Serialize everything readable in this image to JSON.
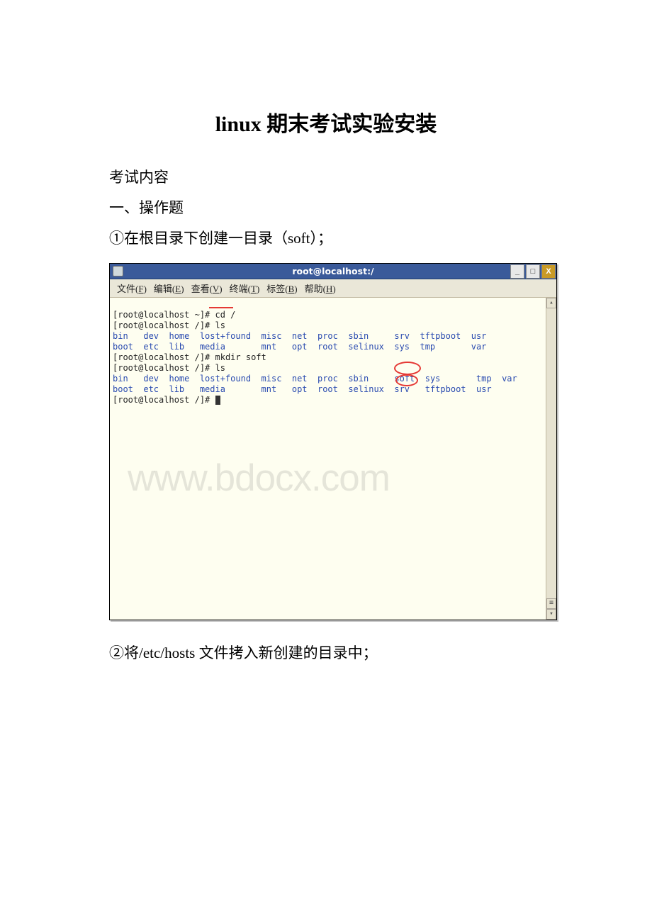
{
  "doc": {
    "title": "linux 期末考试实验安装",
    "subtitle": "考试内容",
    "section": "一、操作题",
    "q1": "①在根目录下创建一目录（soft）；",
    "q2": "②将/etc/hosts 文件拷入新创建的目录中；"
  },
  "terminal": {
    "title": "root@localhost:/",
    "menu": {
      "file": "文件(F)",
      "edit": "编辑(E)",
      "view": "查看(V)",
      "term": "终端(T)",
      "tabs": "标签(B)",
      "help": "帮助(H)"
    },
    "btn": {
      "min": "_",
      "max": "□",
      "close": "X"
    },
    "lines": {
      "l1": "[root@localhost ~]# cd /",
      "l2": "[root@localhost /]# ls",
      "l3a": "bin   dev  home  lost+found  misc  net  proc  sbin     srv  tftpboot  usr",
      "l3b": "boot  etc  lib   media       mnt   opt  root  selinux  sys  tmp       var",
      "l4": "[root@localhost /]# mkdir soft",
      "l5": "[root@localhost /]# ls",
      "l6a_pre": "bin   dev  home  lost+found  misc  net  proc  sbin     ",
      "l6a_soft": "soft",
      "l6a_post": "  sys       tmp  var",
      "l6b_pre": "boot  etc  lib   media       mnt   opt  root  selinux  ",
      "l6b_srv": "srv",
      "l6b_post": "   tftpboot  usr",
      "l7": "[root@localhost /]# "
    },
    "watermark": "www.bdocx.com"
  }
}
